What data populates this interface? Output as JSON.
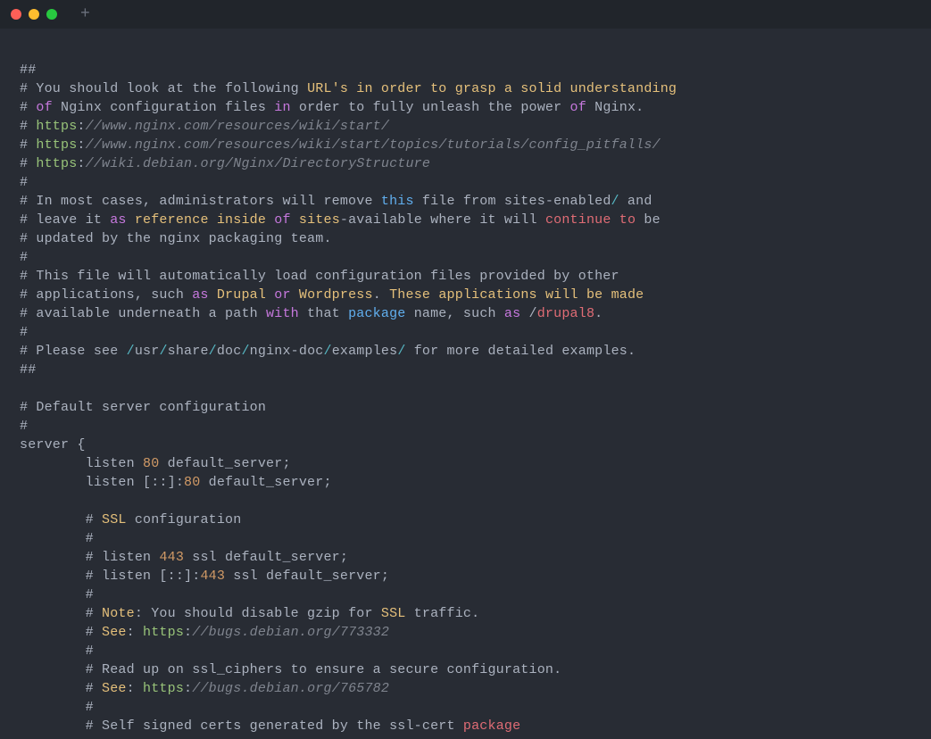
{
  "window": {
    "traffic_lights": [
      "close",
      "minimize",
      "zoom"
    ],
    "new_tab_glyph": "+"
  },
  "code": {
    "lines": [
      [
        {
          "t": "##",
          "cls": "c"
        }
      ],
      [
        {
          "t": "# You should look at the following ",
          "cls": "c"
        },
        {
          "t": "URL",
          "cls": "ye"
        },
        {
          "t": "'s in order to grasp a solid understanding",
          "cls": "ye"
        }
      ],
      [
        {
          "t": "# ",
          "cls": "c"
        },
        {
          "t": "of",
          "cls": "kw"
        },
        {
          "t": " Nginx configuration files ",
          "cls": "c"
        },
        {
          "t": "in",
          "cls": "kw"
        },
        {
          "t": " order to fully unleash the power ",
          "cls": "c"
        },
        {
          "t": "of",
          "cls": "kw"
        },
        {
          "t": " Nginx.",
          "cls": "c"
        }
      ],
      [
        {
          "t": "# ",
          "cls": "c"
        },
        {
          "t": "https",
          "cls": "gr"
        },
        {
          "t": ":",
          "cls": "c"
        },
        {
          "t": "//www.nginx.com/resources/wiki/start/",
          "cls": "gy"
        }
      ],
      [
        {
          "t": "# ",
          "cls": "c"
        },
        {
          "t": "https",
          "cls": "gr"
        },
        {
          "t": ":",
          "cls": "c"
        },
        {
          "t": "//www.nginx.com/resources/wiki/start/topics/tutorials/config_pitfalls/",
          "cls": "gy"
        }
      ],
      [
        {
          "t": "# ",
          "cls": "c"
        },
        {
          "t": "https",
          "cls": "gr"
        },
        {
          "t": ":",
          "cls": "c"
        },
        {
          "t": "//wiki.debian.org/Nginx/DirectoryStructure",
          "cls": "gy"
        }
      ],
      [
        {
          "t": "#",
          "cls": "c"
        }
      ],
      [
        {
          "t": "# In most cases, administrators will remove ",
          "cls": "c"
        },
        {
          "t": "this",
          "cls": "fn"
        },
        {
          "t": " file from sites-enabled",
          "cls": "c"
        },
        {
          "t": "/",
          "cls": "op"
        },
        {
          "t": " and",
          "cls": "c"
        }
      ],
      [
        {
          "t": "# leave it ",
          "cls": "c"
        },
        {
          "t": "as",
          "cls": "kw"
        },
        {
          "t": " ",
          "cls": "c"
        },
        {
          "t": "reference",
          "cls": "ye"
        },
        {
          "t": " ",
          "cls": "c"
        },
        {
          "t": "inside",
          "cls": "ye"
        },
        {
          "t": " ",
          "cls": "c"
        },
        {
          "t": "of",
          "cls": "kw"
        },
        {
          "t": " ",
          "cls": "c"
        },
        {
          "t": "sites",
          "cls": "ye"
        },
        {
          "t": "-available where it will ",
          "cls": "c"
        },
        {
          "t": "continue",
          "cls": "rd"
        },
        {
          "t": " ",
          "cls": "c"
        },
        {
          "t": "to",
          "cls": "rd"
        },
        {
          "t": " be",
          "cls": "c"
        }
      ],
      [
        {
          "t": "# updated by the nginx packaging team.",
          "cls": "c"
        }
      ],
      [
        {
          "t": "#",
          "cls": "c"
        }
      ],
      [
        {
          "t": "# This file will automatically load configuration files provided by other",
          "cls": "c"
        }
      ],
      [
        {
          "t": "# applications, such ",
          "cls": "c"
        },
        {
          "t": "as",
          "cls": "kw"
        },
        {
          "t": " ",
          "cls": "c"
        },
        {
          "t": "Drupal",
          "cls": "ye"
        },
        {
          "t": " ",
          "cls": "c"
        },
        {
          "t": "or",
          "cls": "kw"
        },
        {
          "t": " ",
          "cls": "c"
        },
        {
          "t": "Wordpress",
          "cls": "ye"
        },
        {
          "t": ". ",
          "cls": "c"
        },
        {
          "t": "These",
          "cls": "ye"
        },
        {
          "t": " ",
          "cls": "c"
        },
        {
          "t": "applications",
          "cls": "ye"
        },
        {
          "t": " ",
          "cls": "c"
        },
        {
          "t": "will",
          "cls": "ye"
        },
        {
          "t": " ",
          "cls": "c"
        },
        {
          "t": "be",
          "cls": "ye"
        },
        {
          "t": " ",
          "cls": "c"
        },
        {
          "t": "made",
          "cls": "ye"
        }
      ],
      [
        {
          "t": "# available underneath a path ",
          "cls": "c"
        },
        {
          "t": "with",
          "cls": "kw"
        },
        {
          "t": " that ",
          "cls": "c"
        },
        {
          "t": "package",
          "cls": "fn"
        },
        {
          "t": " name, such ",
          "cls": "c"
        },
        {
          "t": "as",
          "cls": "kw"
        },
        {
          "t": " /",
          "cls": "c"
        },
        {
          "t": "drupal8",
          "cls": "rd"
        },
        {
          "t": ".",
          "cls": "c"
        }
      ],
      [
        {
          "t": "#",
          "cls": "c"
        }
      ],
      [
        {
          "t": "# Please see ",
          "cls": "c"
        },
        {
          "t": "/",
          "cls": "op"
        },
        {
          "t": "usr",
          "cls": "c"
        },
        {
          "t": "/",
          "cls": "op"
        },
        {
          "t": "share",
          "cls": "c"
        },
        {
          "t": "/",
          "cls": "op"
        },
        {
          "t": "doc",
          "cls": "c"
        },
        {
          "t": "/",
          "cls": "op"
        },
        {
          "t": "nginx-doc",
          "cls": "c"
        },
        {
          "t": "/",
          "cls": "op"
        },
        {
          "t": "examples",
          "cls": "c"
        },
        {
          "t": "/",
          "cls": "op"
        },
        {
          "t": " for more detailed examples.",
          "cls": "c"
        }
      ],
      [
        {
          "t": "##",
          "cls": "c"
        }
      ],
      [
        {
          "t": "",
          "cls": "c"
        }
      ],
      [
        {
          "t": "# Default server configuration",
          "cls": "c"
        }
      ],
      [
        {
          "t": "#",
          "cls": "c"
        }
      ],
      [
        {
          "t": "server {",
          "cls": "c"
        }
      ],
      [
        {
          "t": "        listen ",
          "cls": "c"
        },
        {
          "t": "80",
          "cls": "nm"
        },
        {
          "t": " default_server;",
          "cls": "c"
        }
      ],
      [
        {
          "t": "        listen [::]:",
          "cls": "c"
        },
        {
          "t": "80",
          "cls": "nm"
        },
        {
          "t": " default_server;",
          "cls": "c"
        }
      ],
      [
        {
          "t": "",
          "cls": "c"
        }
      ],
      [
        {
          "t": "        # ",
          "cls": "c"
        },
        {
          "t": "SSL",
          "cls": "ye"
        },
        {
          "t": " configuration",
          "cls": "c"
        }
      ],
      [
        {
          "t": "        #",
          "cls": "c"
        }
      ],
      [
        {
          "t": "        # listen ",
          "cls": "c"
        },
        {
          "t": "443",
          "cls": "nm"
        },
        {
          "t": " ssl default_server;",
          "cls": "c"
        }
      ],
      [
        {
          "t": "        # listen [::]:",
          "cls": "c"
        },
        {
          "t": "443",
          "cls": "nm"
        },
        {
          "t": " ssl default_server;",
          "cls": "c"
        }
      ],
      [
        {
          "t": "        #",
          "cls": "c"
        }
      ],
      [
        {
          "t": "        # ",
          "cls": "c"
        },
        {
          "t": "Note",
          "cls": "ye"
        },
        {
          "t": ": You should disable gzip for ",
          "cls": "c"
        },
        {
          "t": "SSL",
          "cls": "ye"
        },
        {
          "t": " traffic.",
          "cls": "c"
        }
      ],
      [
        {
          "t": "        # ",
          "cls": "c"
        },
        {
          "t": "See",
          "cls": "ye"
        },
        {
          "t": ": ",
          "cls": "c"
        },
        {
          "t": "https",
          "cls": "gr"
        },
        {
          "t": ":",
          "cls": "c"
        },
        {
          "t": "//bugs.debian.org/773332",
          "cls": "gy"
        }
      ],
      [
        {
          "t": "        #",
          "cls": "c"
        }
      ],
      [
        {
          "t": "        # Read up on ssl_ciphers to ensure a secure configuration.",
          "cls": "c"
        }
      ],
      [
        {
          "t": "        # ",
          "cls": "c"
        },
        {
          "t": "See",
          "cls": "ye"
        },
        {
          "t": ": ",
          "cls": "c"
        },
        {
          "t": "https",
          "cls": "gr"
        },
        {
          "t": ":",
          "cls": "c"
        },
        {
          "t": "//bugs.debian.org/765782",
          "cls": "gy"
        }
      ],
      [
        {
          "t": "        #",
          "cls": "c"
        }
      ],
      [
        {
          "t": "        # Self signed certs generated by the ssl-cert ",
          "cls": "c"
        },
        {
          "t": "package",
          "cls": "rd"
        }
      ]
    ]
  }
}
